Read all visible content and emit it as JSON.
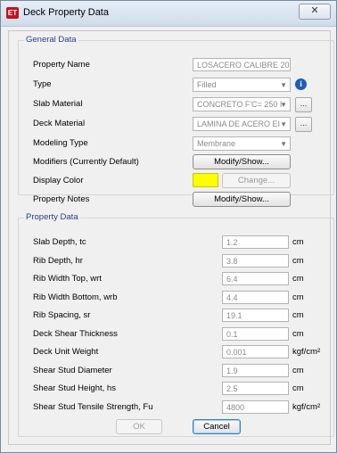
{
  "window": {
    "title": "Deck Property Data",
    "close_glyph": "✕",
    "app_icon_text": "ET"
  },
  "general": {
    "group_title": "General Data",
    "property_name": {
      "label": "Property Name",
      "value": "LOSACERO CALIBRE 20..."
    },
    "type": {
      "label": "Type",
      "value": "Filled"
    },
    "slab_material": {
      "label": "Slab Material",
      "value": "CONCRETO F'C= 250 I"
    },
    "deck_material": {
      "label": "Deck Material",
      "value": "LAMINA DE ACERO EI"
    },
    "modeling_type": {
      "label": "Modeling Type",
      "value": "Membrane"
    },
    "modifiers": {
      "label": "Modifiers (Currently Default)",
      "button": "Modify/Show..."
    },
    "display_color": {
      "label": "Display Color",
      "button": "Change...",
      "color": "#ffff00"
    },
    "property_notes": {
      "label": "Property Notes",
      "button": "Modify/Show..."
    },
    "dots_label": "..."
  },
  "property": {
    "group_title": "Property Data",
    "rows": [
      {
        "label": "Slab Depth, tc",
        "value": "1.2",
        "unit": "cm"
      },
      {
        "label": "Rib Depth, hr",
        "value": "3.8",
        "unit": "cm"
      },
      {
        "label": "Rib Width Top, wrt",
        "value": "6.4",
        "unit": "cm"
      },
      {
        "label": "Rib Width Bottom, wrb",
        "value": "4.4",
        "unit": "cm"
      },
      {
        "label": "Rib Spacing, sr",
        "value": "19.1",
        "unit": "cm"
      },
      {
        "label": "Deck Shear Thickness",
        "value": "0.1",
        "unit": "cm"
      },
      {
        "label": "Deck Unit Weight",
        "value": "0.001",
        "unit": "kgf/cm²"
      },
      {
        "label": "Shear Stud Diameter",
        "value": "1.9",
        "unit": "cm"
      },
      {
        "label": "Shear Stud Height, hs",
        "value": "2.5",
        "unit": "cm"
      },
      {
        "label": "Shear Stud Tensile Strength, Fu",
        "value": "4800",
        "unit": "kgf/cm²"
      }
    ]
  },
  "footer": {
    "ok_label": "OK",
    "cancel_label": "Cancel"
  }
}
